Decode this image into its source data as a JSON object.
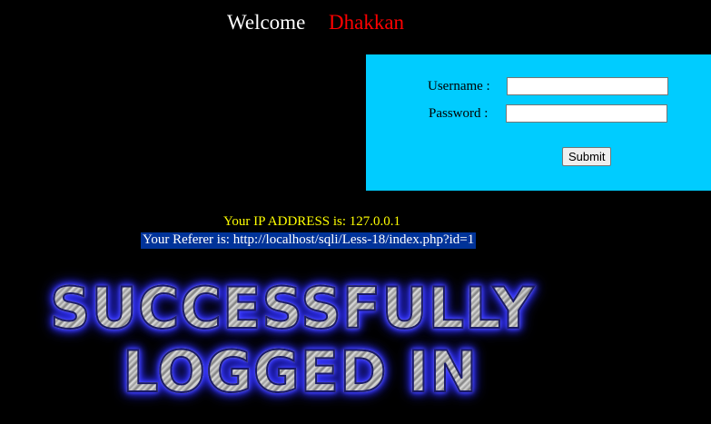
{
  "welcome": {
    "greeting": "Welcome",
    "username": "Dhakkan"
  },
  "login_form": {
    "username_label": "Username :",
    "password_label": "Password :",
    "username_value": "",
    "password_value": "",
    "submit_label": "Submit"
  },
  "info": {
    "ip_address": "Your IP ADDRESS is: 127.0.0.1",
    "referer": "Your Referer is: http://localhost/sqli/Less-18/index.php?id=1"
  },
  "banner": {
    "line1": "SUCCESSFULLY",
    "line2": "LOGGED IN"
  },
  "colors": {
    "background": "#000000",
    "form_panel": "#00ccff",
    "username_highlight": "#ff0000",
    "ip_text": "#ffff00",
    "referer_highlight": "#003399"
  }
}
